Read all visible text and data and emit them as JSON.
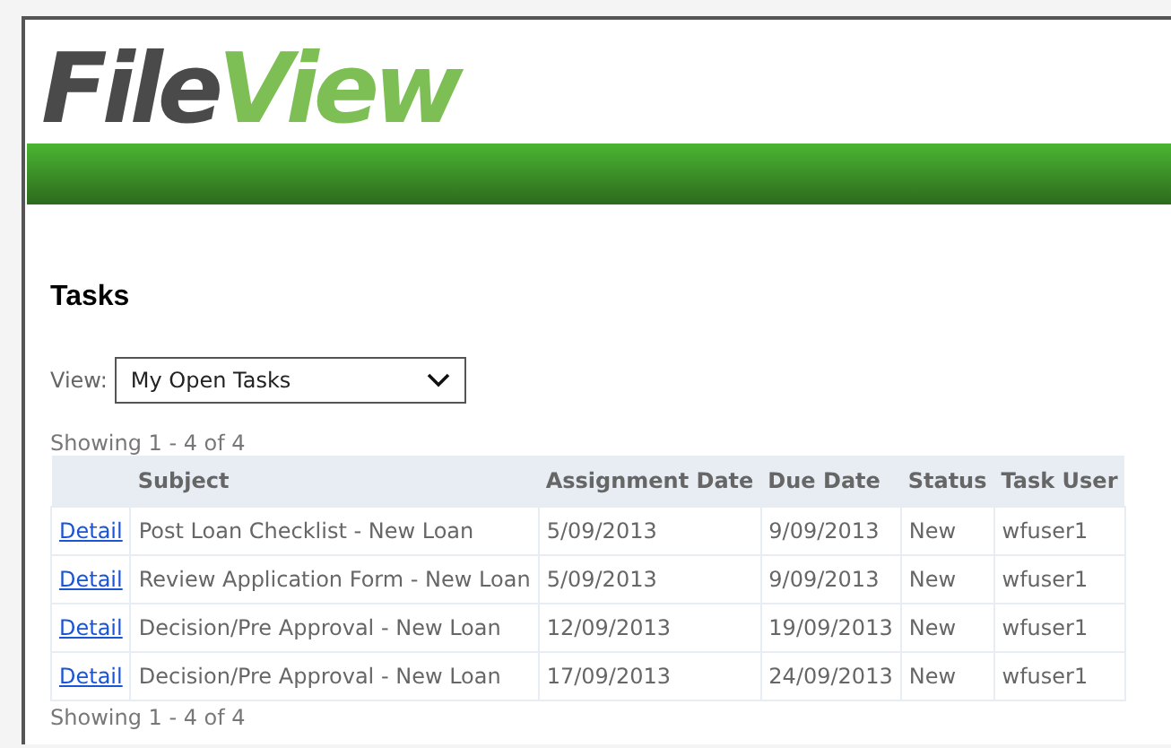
{
  "logo": {
    "part_1": "File",
    "part_2": "View"
  },
  "heading": "Tasks",
  "view_filter": {
    "label": "View:",
    "value": "My Open Tasks"
  },
  "summary_top": "Showing 1 - 4 of 4",
  "table": {
    "columns": [
      "",
      "Subject",
      "Assignment Date",
      "Due Date",
      "Status",
      "Task User"
    ],
    "rows": [
      {
        "link": "Detail",
        "subject": "Post Loan Checklist - New Loan",
        "assignment_date": "5/09/2013",
        "due_date": "9/09/2013",
        "status": "New",
        "task_user": "wfuser1"
      },
      {
        "link": "Detail",
        "subject": "Review Application Form - New Loan",
        "assignment_date": "5/09/2013",
        "due_date": "9/09/2013",
        "status": "New",
        "task_user": "wfuser1"
      },
      {
        "link": "Detail",
        "subject": "Decision/Pre Approval - New Loan",
        "assignment_date": "12/09/2013",
        "due_date": "19/09/2013",
        "status": "New",
        "task_user": "wfuser1"
      },
      {
        "link": "Detail",
        "subject": "Decision/Pre Approval - New Loan",
        "assignment_date": "17/09/2013",
        "due_date": "24/09/2013",
        "status": "New",
        "task_user": "wfuser1"
      }
    ]
  },
  "summary_bottom": "Showing 1 - 4 of 4"
}
